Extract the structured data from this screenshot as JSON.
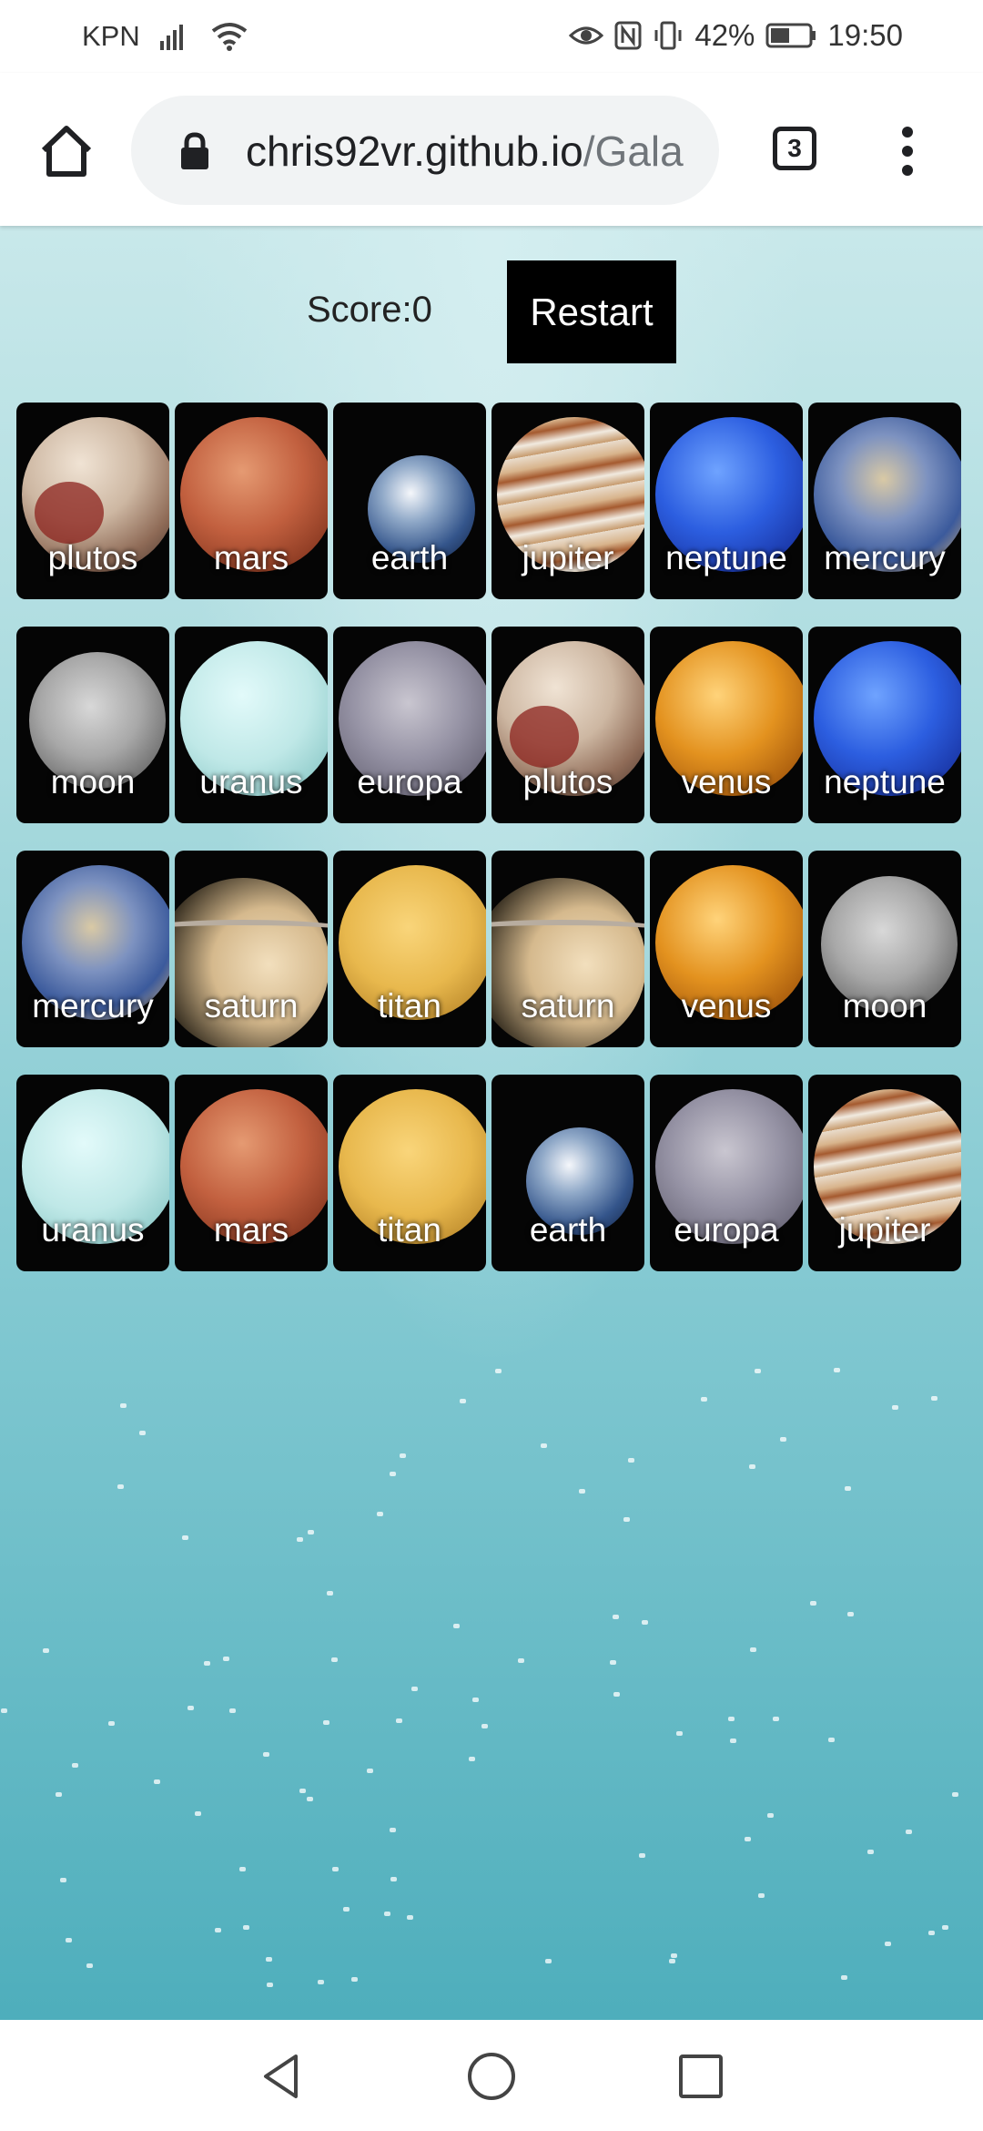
{
  "status_bar": {
    "carrier": "KPN",
    "battery": "42%",
    "time": "19:50",
    "icons": [
      "signal-icon",
      "wifi-icon",
      "eye-icon",
      "nfc-icon",
      "vibrate-icon",
      "battery-icon"
    ]
  },
  "browser": {
    "url_main": "chris92vr.github.io",
    "url_rest": "/Gala",
    "tab_count": "3"
  },
  "game": {
    "score_text": "Score:0",
    "restart_label": "Restart",
    "cards": [
      {
        "label": "plutos"
      },
      {
        "label": "mars"
      },
      {
        "label": "earth"
      },
      {
        "label": "jupiter"
      },
      {
        "label": "neptune"
      },
      {
        "label": "mercury"
      },
      {
        "label": "moon"
      },
      {
        "label": "uranus"
      },
      {
        "label": "europa"
      },
      {
        "label": "plutos"
      },
      {
        "label": "venus"
      },
      {
        "label": "neptune"
      },
      {
        "label": "mercury"
      },
      {
        "label": "saturn"
      },
      {
        "label": "titan"
      },
      {
        "label": "saturn"
      },
      {
        "label": "venus"
      },
      {
        "label": "moon"
      },
      {
        "label": "uranus"
      },
      {
        "label": "mars"
      },
      {
        "label": "titan"
      },
      {
        "label": "earth"
      },
      {
        "label": "europa"
      },
      {
        "label": "jupiter"
      }
    ]
  }
}
